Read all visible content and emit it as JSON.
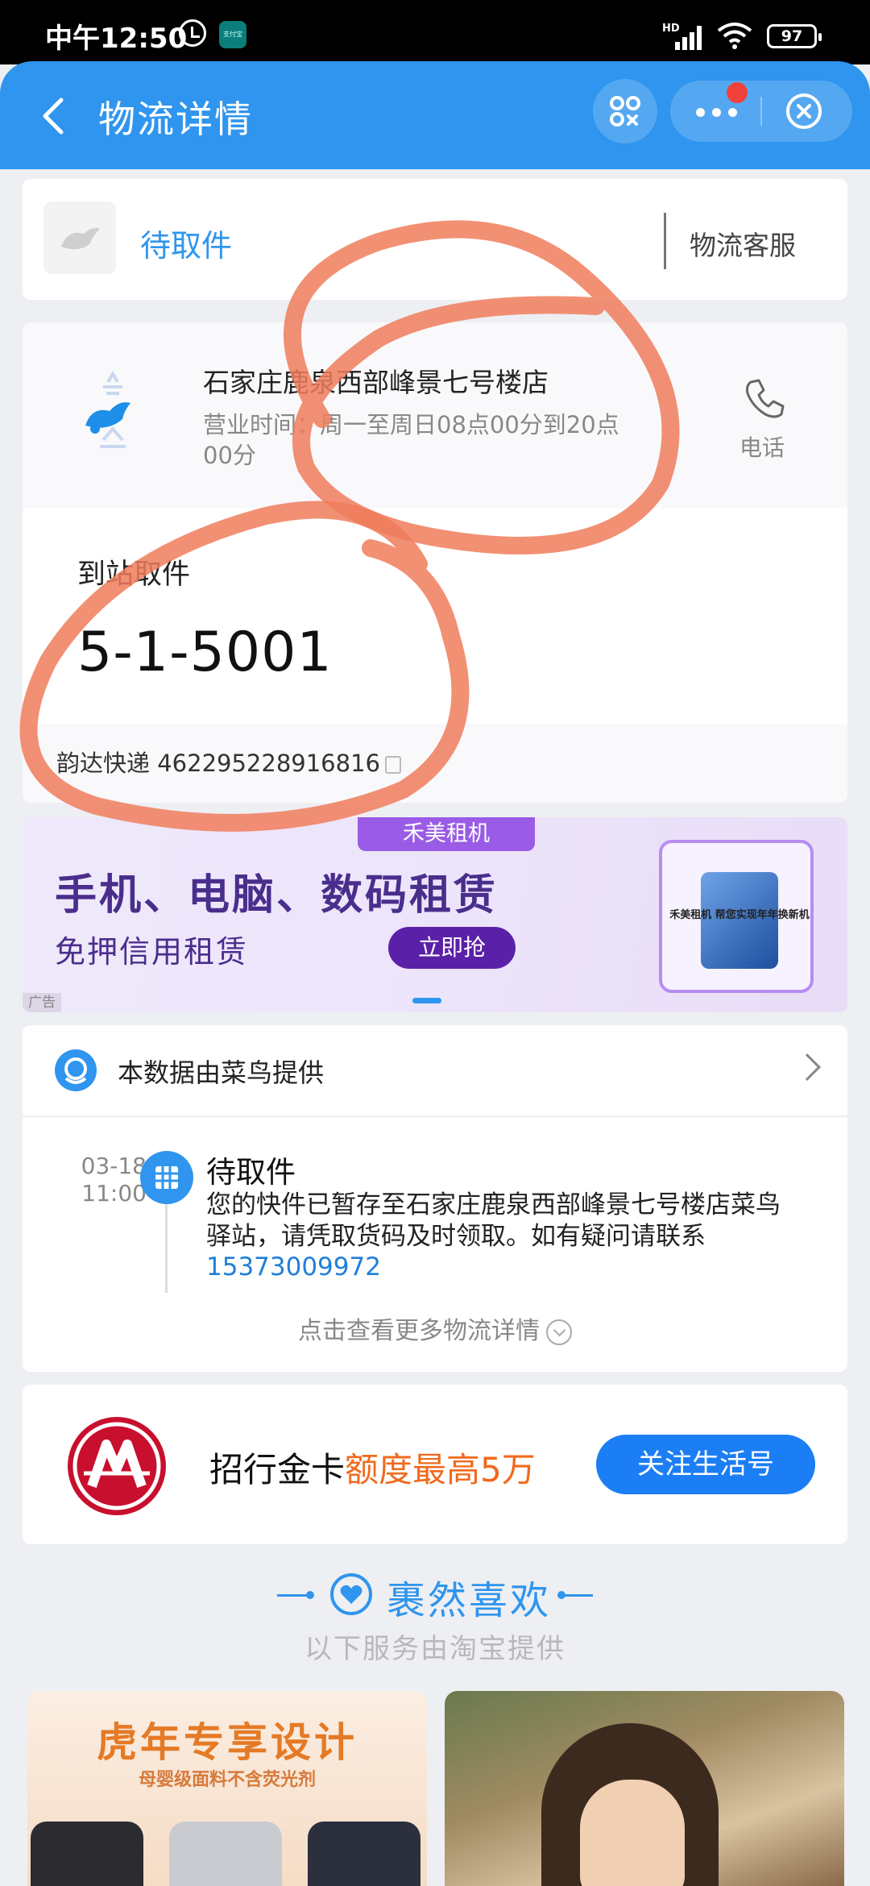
{
  "status_bar": {
    "time": "中午12:50",
    "app_icon_text": "支付宝",
    "network": "HD",
    "battery": "97"
  },
  "nav": {
    "title": "物流详情",
    "icons": [
      "back-arrow-icon",
      "mini-program-icon",
      "more-icon",
      "close-icon"
    ]
  },
  "status": {
    "label": "待取件",
    "service": "物流客服"
  },
  "station": {
    "name": "石家庄鹿泉西部峰景七号楼店",
    "hours": "营业时间：周一至周日08点00分到20点00分",
    "phone_label": "电话",
    "pickup_label": "到站取件",
    "pickup_code": "5-1-5001",
    "tracking": "韵达快递 462295228916816"
  },
  "ad": {
    "tag": "禾美租机",
    "headline": "手机、电脑、数码租赁",
    "sub": "免押信用租赁",
    "cta": "立即抢",
    "product_text": "禾美租机 帮您实现年年换新机",
    "ad_label": "广告"
  },
  "cainiao": {
    "provider": "本数据由菜鸟提供",
    "event": {
      "date": "03-18",
      "time": "11:00",
      "title": "待取件",
      "desc": "您的快件已暂存至石家庄鹿泉西部峰景七号楼店菜鸟驿站，请凭取货码及时领取。如有疑问请联系",
      "phone": "15373009972"
    },
    "more_link": "点击查看更多物流详情"
  },
  "bank": {
    "text_main": "招行金卡",
    "text_highlight": "额度最高5万",
    "follow_label": "关注生活号"
  },
  "recommend": {
    "title": "裹然喜欢",
    "subtitle": "以下服务由淘宝提供",
    "tile1_title": "虎年专享设计",
    "tile1_sub": "母婴级面料不含荧光剂"
  },
  "colors": {
    "primary": "#2f95ee",
    "bank_highlight": "#f06a1d",
    "follow_button": "#1b7ef5",
    "annotation": "#f07c5c"
  }
}
